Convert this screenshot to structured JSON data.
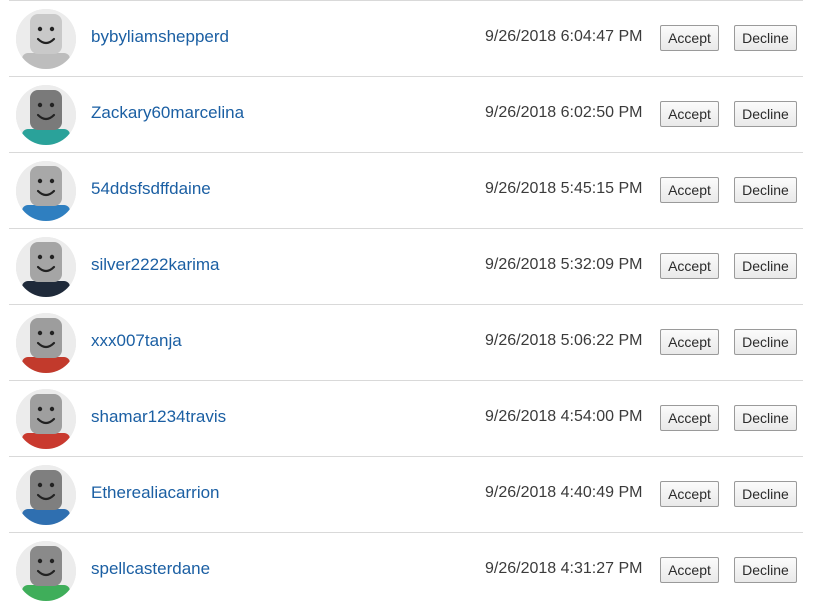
{
  "requests": [
    {
      "username": "bybyliamshepperd",
      "timestamp": "9/26/2018 6:04:47 PM",
      "accept_label": "Accept",
      "decline_label": "Decline",
      "head_color": "#c9c9c9",
      "torso_color": "#bdbdbd"
    },
    {
      "username": "Zackary60marcelina",
      "timestamp": "9/26/2018 6:02:50 PM",
      "accept_label": "Accept",
      "decline_label": "Decline",
      "head_color": "#7a7a7a",
      "torso_color": "#2aa29a"
    },
    {
      "username": "54ddsfsdffdaine",
      "timestamp": "9/26/2018 5:45:15 PM",
      "accept_label": "Accept",
      "decline_label": "Decline",
      "head_color": "#a8a8a8",
      "torso_color": "#2f7fc0"
    },
    {
      "username": "silver2222karima",
      "timestamp": "9/26/2018 5:32:09 PM",
      "accept_label": "Accept",
      "decline_label": "Decline",
      "head_color": "#a5a5a5",
      "torso_color": "#1f2a3a"
    },
    {
      "username": "xxx007tanja",
      "timestamp": "9/26/2018 5:06:22 PM",
      "accept_label": "Accept",
      "decline_label": "Decline",
      "head_color": "#9d9d9d",
      "torso_color": "#c23a2c"
    },
    {
      "username": "shamar1234travis",
      "timestamp": "9/26/2018 4:54:00 PM",
      "accept_label": "Accept",
      "decline_label": "Decline",
      "head_color": "#9f9f9f",
      "torso_color": "#c93a2f"
    },
    {
      "username": "Etherealiacarrion",
      "timestamp": "9/26/2018 4:40:49 PM",
      "accept_label": "Accept",
      "decline_label": "Decline",
      "head_color": "#7f7f7f",
      "torso_color": "#2f6fb0"
    },
    {
      "username": "spellcasterdane",
      "timestamp": "9/26/2018 4:31:27 PM",
      "accept_label": "Accept",
      "decline_label": "Decline",
      "head_color": "#8a8a8a",
      "torso_color": "#3fae5a"
    }
  ],
  "icons": {
    "avatar": "avatar-icon"
  }
}
